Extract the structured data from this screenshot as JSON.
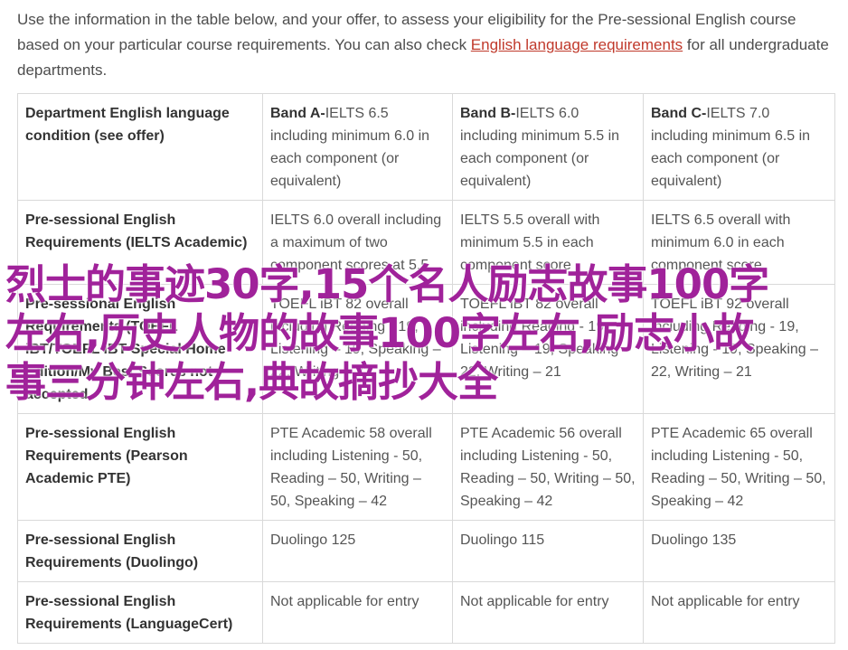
{
  "intro": {
    "text_before": "Use the information in the table below, and your offer, to assess your eligibility for the Pre-sessional English course based on your particular course requirements. You can also check ",
    "link_text": "English language requirements",
    "text_after": " for all undergraduate departments."
  },
  "table": {
    "header": {
      "condition": "Department English language condition (see offer)",
      "bands": [
        {
          "name": "Band A-",
          "desc": "IELTS 6.5 including minimum 6.0 in each component (or equivalent)"
        },
        {
          "name": "Band B-",
          "desc": "IELTS 6.0 including minimum 5.5 in each component (or equivalent)"
        },
        {
          "name": "Band C-",
          "desc": "IELTS 7.0 including minimum 6.5 in each component (or equivalent)"
        }
      ]
    },
    "rows": [
      {
        "label": "Pre-sessional English Requirements (IELTS Academic)",
        "cells": [
          "IELTS 6.0 overall including a maximum of two component scores at 5.5",
          "IELTS 5.5 overall with minimum 5.5 in each component score",
          "IELTS 6.5 overall with minimum 6.0 in each component score"
        ]
      },
      {
        "label": "Pre-sessional English Requirements (TOEFL iBT/TOEFL iBT Special Home Edition/My Best Scores not accepted",
        "cells": [
          "TOEFL iBT 82 overall including Reading - 19, Listening – 19, Speaking – 22, Writing – 21",
          "TOEFL iBT 82 overall including Reading - 19, Listening – 19, Speaking – 22, Writing – 21",
          "TOEFL iBT 92 overall including Reading - 19, Listening - 19, Speaking – 22, Writing – 21"
        ]
      },
      {
        "label": "Pre-sessional English Requirements (Pearson Academic PTE)",
        "cells": [
          "PTE Academic 58 overall including Listening - 50, Reading – 50, Writing – 50, Speaking – 42",
          "PTE Academic 56 overall including Listening - 50, Reading – 50, Writing – 50, Speaking – 42",
          "PTE Academic 65 overall including Listening - 50, Reading – 50, Writing – 50, Speaking – 42"
        ]
      },
      {
        "label": "Pre-sessional English Requirements (Duolingo)",
        "cells": [
          "Duolingo 125",
          "Duolingo 115",
          "Duolingo 135"
        ]
      },
      {
        "label": "Pre-sessional English Requirements (LanguageCert)",
        "cells": [
          "Not applicable for entry",
          "Not applicable for entry",
          "Not applicable for entry"
        ]
      }
    ]
  },
  "watermark": {
    "text": "烈士的事迹30字,15个名人励志故事100字左右,历史人物的故事100字左右,励志小故事三分钟左右,典故摘抄大全"
  },
  "colors": {
    "link": "#c0392b",
    "watermark": "#a0229a",
    "border": "#d9d9d9"
  }
}
